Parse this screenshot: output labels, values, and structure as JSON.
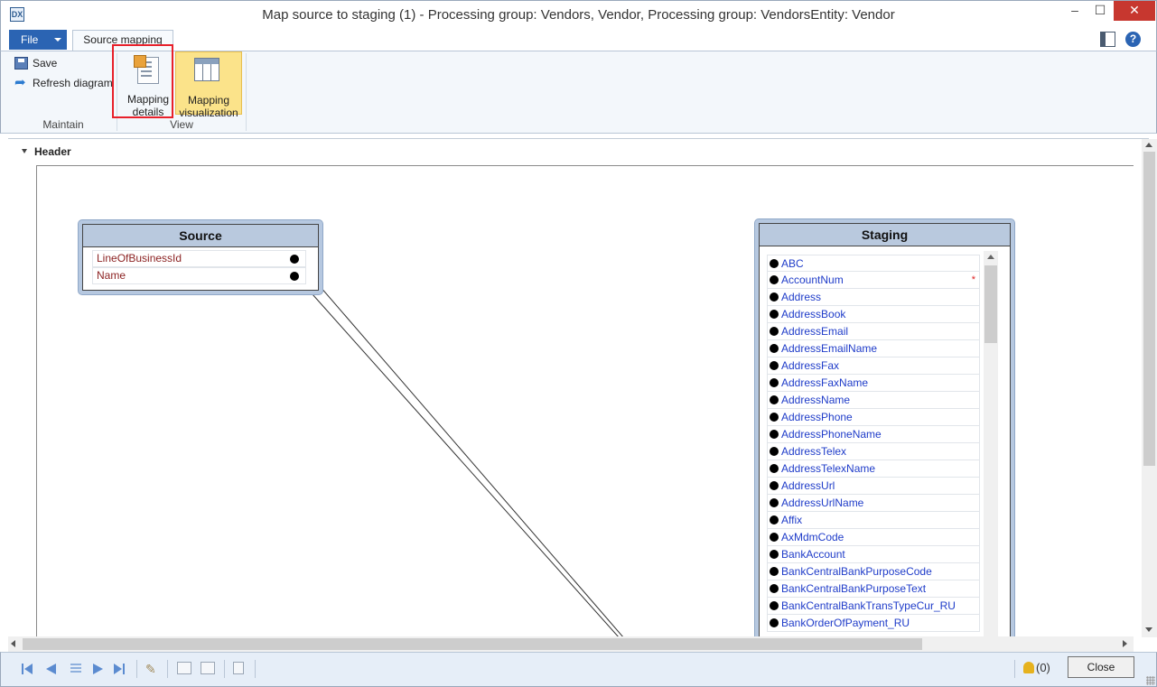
{
  "window": {
    "title": "Map source to staging (1) - Processing group: Vendors, Vendor, Processing group: VendorsEntity: Vendor",
    "minimize": "–",
    "maximize": "☐",
    "close": "✕"
  },
  "ribbon": {
    "file_tab": "File",
    "active_tab": "Source mapping",
    "groups": {
      "maintain": {
        "label": "Maintain",
        "save": "Save",
        "refresh": "Refresh diagram"
      },
      "view": {
        "label": "View",
        "mapping_details_line1": "Mapping",
        "mapping_details_line2": "details",
        "mapping_viz_line1": "Mapping",
        "mapping_viz_line2": "visualization"
      }
    },
    "help": "?"
  },
  "content": {
    "section_header": "Header",
    "source": {
      "title": "Source",
      "fields": [
        "LineOfBusinessId",
        "Name"
      ]
    },
    "staging": {
      "title": "Staging",
      "fields": [
        {
          "name": "ABC",
          "required": ""
        },
        {
          "name": "AccountNum",
          "required": "*"
        },
        {
          "name": "Address",
          "required": ""
        },
        {
          "name": "AddressBook",
          "required": ""
        },
        {
          "name": "AddressEmail",
          "required": ""
        },
        {
          "name": "AddressEmailName",
          "required": ""
        },
        {
          "name": "AddressFax",
          "required": ""
        },
        {
          "name": "AddressFaxName",
          "required": ""
        },
        {
          "name": "AddressName",
          "required": ""
        },
        {
          "name": "AddressPhone",
          "required": ""
        },
        {
          "name": "AddressPhoneName",
          "required": ""
        },
        {
          "name": "AddressTelex",
          "required": ""
        },
        {
          "name": "AddressTelexName",
          "required": ""
        },
        {
          "name": "AddressUrl",
          "required": ""
        },
        {
          "name": "AddressUrlName",
          "required": ""
        },
        {
          "name": "Affix",
          "required": ""
        },
        {
          "name": "AxMdmCode",
          "required": ""
        },
        {
          "name": "BankAccount",
          "required": ""
        },
        {
          "name": "BankCentralBankPurposeCode",
          "required": ""
        },
        {
          "name": "BankCentralBankPurposeText",
          "required": ""
        },
        {
          "name": "BankCentralBankTransTypeCur_RU",
          "required": ""
        },
        {
          "name": "BankOrderOfPayment_RU",
          "required": ""
        }
      ]
    }
  },
  "statusbar": {
    "notifications": "(0)",
    "close": "Close"
  },
  "colors": {
    "accent": "#2b64b3",
    "highlight": "#e8202a",
    "active_button": "#fbe38a",
    "source_field_text": "#8c2323",
    "staging_field_text": "#1f3cc9"
  }
}
